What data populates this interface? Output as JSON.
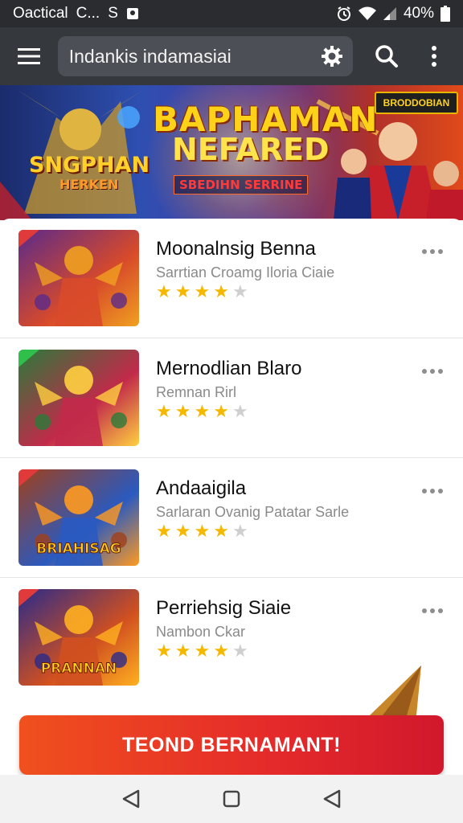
{
  "status_bar": {
    "left_text": "Oactical",
    "carrier": "C...",
    "sim_label": "S",
    "battery_text": "40%",
    "icons": [
      "image-icon",
      "alarm-icon",
      "wifi-icon",
      "signal-icon",
      "battery-icon"
    ]
  },
  "app_bar": {
    "menu_icon": "hamburger-menu-icon",
    "search_text": "Indankis indamasiai",
    "settings_icon": "gear-icon",
    "search_icon": "search-icon",
    "overflow_icon": "more-vertical-icon"
  },
  "banner": {
    "logo_text": "SNGPHAN",
    "logo_sub": "HERKEN",
    "title": "BAPHAMAN",
    "subtitle": "NEFARED",
    "tag": "SBEDIHN SERRINE",
    "badge": "BRODDOBIAN"
  },
  "items": [
    {
      "title": "Moonalnsig Benna",
      "subtitle": "Sarrtian Croamg Iloria Ciaie",
      "rating": 4,
      "max_rating": 5,
      "thumb_colors": [
        "#5b2a8a",
        "#d84a2a",
        "#f0a020"
      ]
    },
    {
      "title": "Mernodlian Blaro",
      "subtitle": "Remnan Rirl",
      "rating": 4,
      "max_rating": 5,
      "thumb_colors": [
        "#2a7a3a",
        "#c22a4a",
        "#ffd040"
      ]
    },
    {
      "title": "Andaaigila",
      "subtitle": "Sarlaran Ovanig Patatar Sarle",
      "rating": 4,
      "max_rating": 5,
      "thumb_colors": [
        "#a0401a",
        "#2a5ac0",
        "#ff9a20"
      ]
    },
    {
      "title": "Perriehsig Siaie",
      "subtitle": "Nambon Ckar",
      "rating": 4,
      "max_rating": 5,
      "thumb_colors": [
        "#2a2a8a",
        "#d05020",
        "#ffb020"
      ]
    }
  ],
  "thumb_labels": [
    "",
    "",
    "BRIAHISAG",
    "PRANNAN"
  ],
  "cta": {
    "label": "TEOND BERNAMANT!"
  },
  "colors": {
    "cta_start": "#f0501e",
    "cta_end": "#d1182c",
    "star_filled": "#f5b800",
    "star_empty": "#cfcfcf",
    "app_bar": "#35383d"
  },
  "nav_bar": {
    "back_icon": "back-triangle-icon",
    "home_icon": "home-square-icon",
    "recents_icon": "back-triangle-icon"
  }
}
